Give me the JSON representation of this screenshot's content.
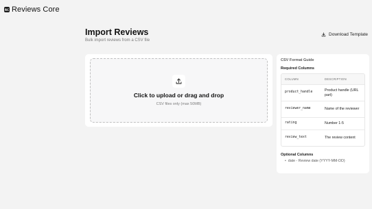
{
  "app": {
    "logo_text": "RC",
    "title": "Reviews Core"
  },
  "header": {
    "title": "Import Reviews",
    "subtitle": "Bulk import reviews from a CSV file"
  },
  "download_button": {
    "label": "Download Template",
    "icon": "download-icon"
  },
  "upload": {
    "icon": "upload-icon",
    "title": "Click to upload or drag and drop",
    "hint": "CSV files only (max 50MB)"
  },
  "guide": {
    "title": "CSV Format Guide",
    "required_label": "Required Columns",
    "table_headers": {
      "column": "COLUMN",
      "description": "DESCRIPTION"
    },
    "required": [
      {
        "column": "product_handle",
        "description": "Product handle (URL part)"
      },
      {
        "column": "reviewer_name",
        "description": "Name of the reviewer"
      },
      {
        "column": "rating",
        "description": "Number 1-5"
      },
      {
        "column": "review_text",
        "description": "The review content"
      }
    ],
    "optional_label": "Optional Columns",
    "optional": [
      {
        "bullet": "•",
        "text": "date - Review date (YYYY-MM-DD)"
      }
    ]
  }
}
